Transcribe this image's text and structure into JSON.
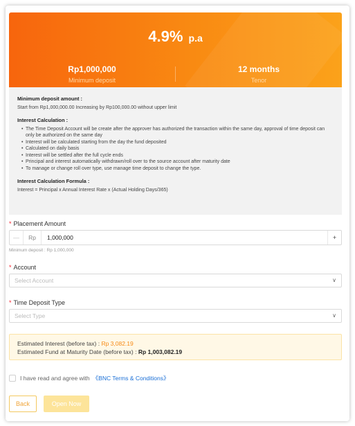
{
  "banner": {
    "rate_value": "4.9%",
    "rate_unit": "p.a",
    "min_deposit_value": "Rp1,000,000",
    "min_deposit_label": "Minimum deposit",
    "tenor_value": "12 months",
    "tenor_label": "Tenor"
  },
  "terms": {
    "min_amount_title": "Minimum deposit amount :",
    "min_amount_text": "Start from Rp1,000,000.00 Increasing by Rp100,000.00 without upper limit",
    "calc_title": "Interest Calculation :",
    "calc_items": [
      "The Time Deposit Account will be create after the approver has authorized the transaction within the same day, approval of time deposit can only be authorized on the same day",
      "Interest will be calculated starting from the day the fund deposited",
      "Calculated on daily basis",
      "Interest will be settled after the full cycle ends",
      "Principal and interest automatically withdrawn/roll over to the source account after maturity date",
      "To manage or change roll over type, use manage time deposit to change the type."
    ],
    "formula_title": "Interest Calculation Formula :",
    "formula_text": "Interest = Principal x Annual Interest Rate x (Actual Holding Days/365)"
  },
  "form": {
    "required_mark": "*",
    "placement_label": "Placement Amount",
    "minus_symbol": "—",
    "currency_prefix": "Rp",
    "amount_value": "1,000,000",
    "plus_symbol": "+",
    "amount_hint": "Minimum deposit : Rp 1,000,000",
    "account_label": "Account",
    "account_placeholder": "Select Account",
    "type_label": "Time Deposit Type",
    "type_placeholder": "Select Type"
  },
  "estimate": {
    "interest_label": "Estimated Interest (before tax) :",
    "interest_value": "Rp 3,082.19",
    "fund_label": "Estimated Fund at Maturity Date (before tax) :",
    "fund_value": "Rp 1,003,082.19"
  },
  "agree": {
    "text": "I have read and agree with",
    "link": "《BNC Terms & Conditions》"
  },
  "buttons": {
    "back": "Back",
    "open": "Open Now"
  },
  "icons": {
    "chevron": "chevron-down-icon"
  },
  "colors": {
    "banner_start": "#f7650d",
    "banner_end": "#fba21a",
    "accent_orange": "#f78b17",
    "required_red": "#f5222d",
    "link_blue": "#1a6fd6",
    "open_button_bg": "#fde49a"
  }
}
